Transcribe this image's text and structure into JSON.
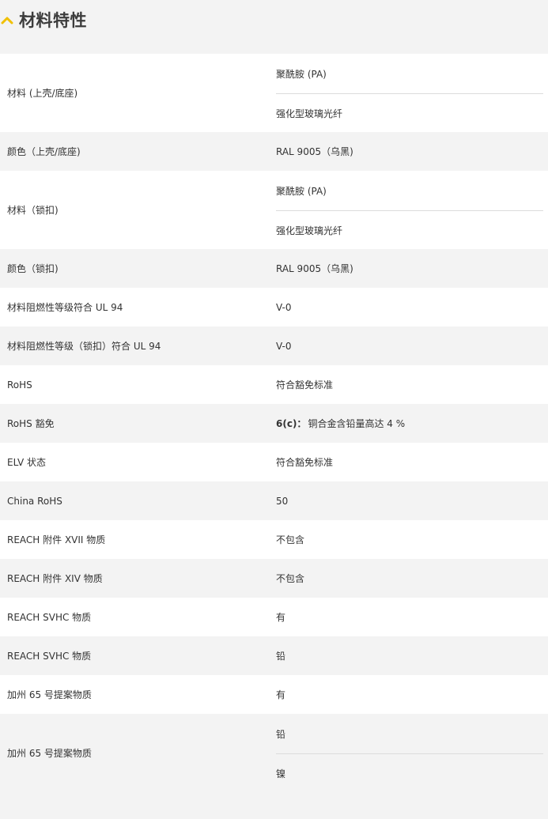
{
  "section": {
    "title": "材料特性",
    "accent": "#f0c000"
  },
  "rows": [
    {
      "label": "材料 (上壳/底座)",
      "values": [
        "聚酰胺 (PA)",
        "强化型玻璃光纤"
      ]
    },
    {
      "label": "颜色（上壳/底座)",
      "values": [
        "RAL 9005（乌黑)"
      ]
    },
    {
      "label": "材料（锁扣)",
      "values": [
        "聚酰胺 (PA)",
        "强化型玻璃光纤"
      ]
    },
    {
      "label": "颜色（锁扣)",
      "values": [
        "RAL 9005（乌黑)"
      ]
    },
    {
      "label": "材料阻燃性等级符合 UL 94",
      "values": [
        "V-0"
      ]
    },
    {
      "label": "材料阻燃性等级（锁扣）符合 UL 94",
      "values": [
        "V-0"
      ]
    },
    {
      "label": "RoHS",
      "values": [
        "符合豁免标准"
      ]
    },
    {
      "label": "RoHS 豁免",
      "values": [
        "6(c)：铜合金含铅量高达 4 %"
      ],
      "bold_prefix": "6(c)："
    },
    {
      "label": "ELV 状态",
      "values": [
        "符合豁免标准"
      ]
    },
    {
      "label": "China RoHS",
      "values": [
        "50"
      ]
    },
    {
      "label": "REACH 附件 XVII 物质",
      "values": [
        "不包含"
      ]
    },
    {
      "label": "REACH 附件 XIV 物质",
      "values": [
        "不包含"
      ]
    },
    {
      "label": "REACH SVHC 物质",
      "values": [
        "有"
      ]
    },
    {
      "label": "REACH SVHC 物质",
      "values": [
        "铅"
      ]
    },
    {
      "label": "加州 65 号提案物质",
      "values": [
        "有"
      ]
    },
    {
      "label": "加州 65 号提案物质",
      "values": [
        "铅",
        "镍"
      ]
    }
  ]
}
